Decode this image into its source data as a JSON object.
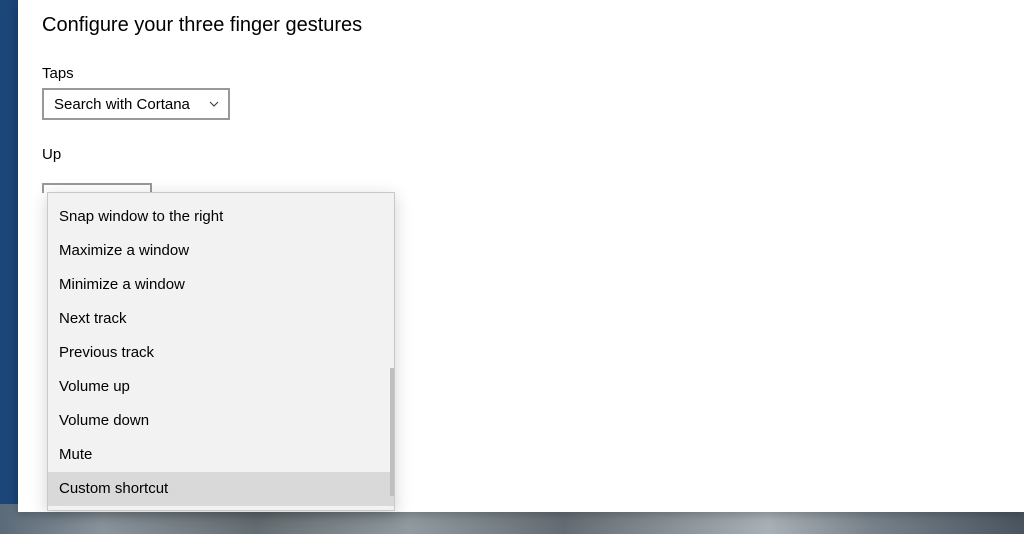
{
  "page_title": "Configure your three finger gestures",
  "taps": {
    "label": "Taps",
    "selected": "Search with Cortana"
  },
  "up": {
    "label": "Up",
    "dropdown": {
      "options": [
        "Snap window to the right",
        "Maximize a window",
        "Minimize a window",
        "Next track",
        "Previous track",
        "Volume up",
        "Volume down",
        "Mute",
        "Custom shortcut"
      ],
      "selected_index": 8
    }
  }
}
